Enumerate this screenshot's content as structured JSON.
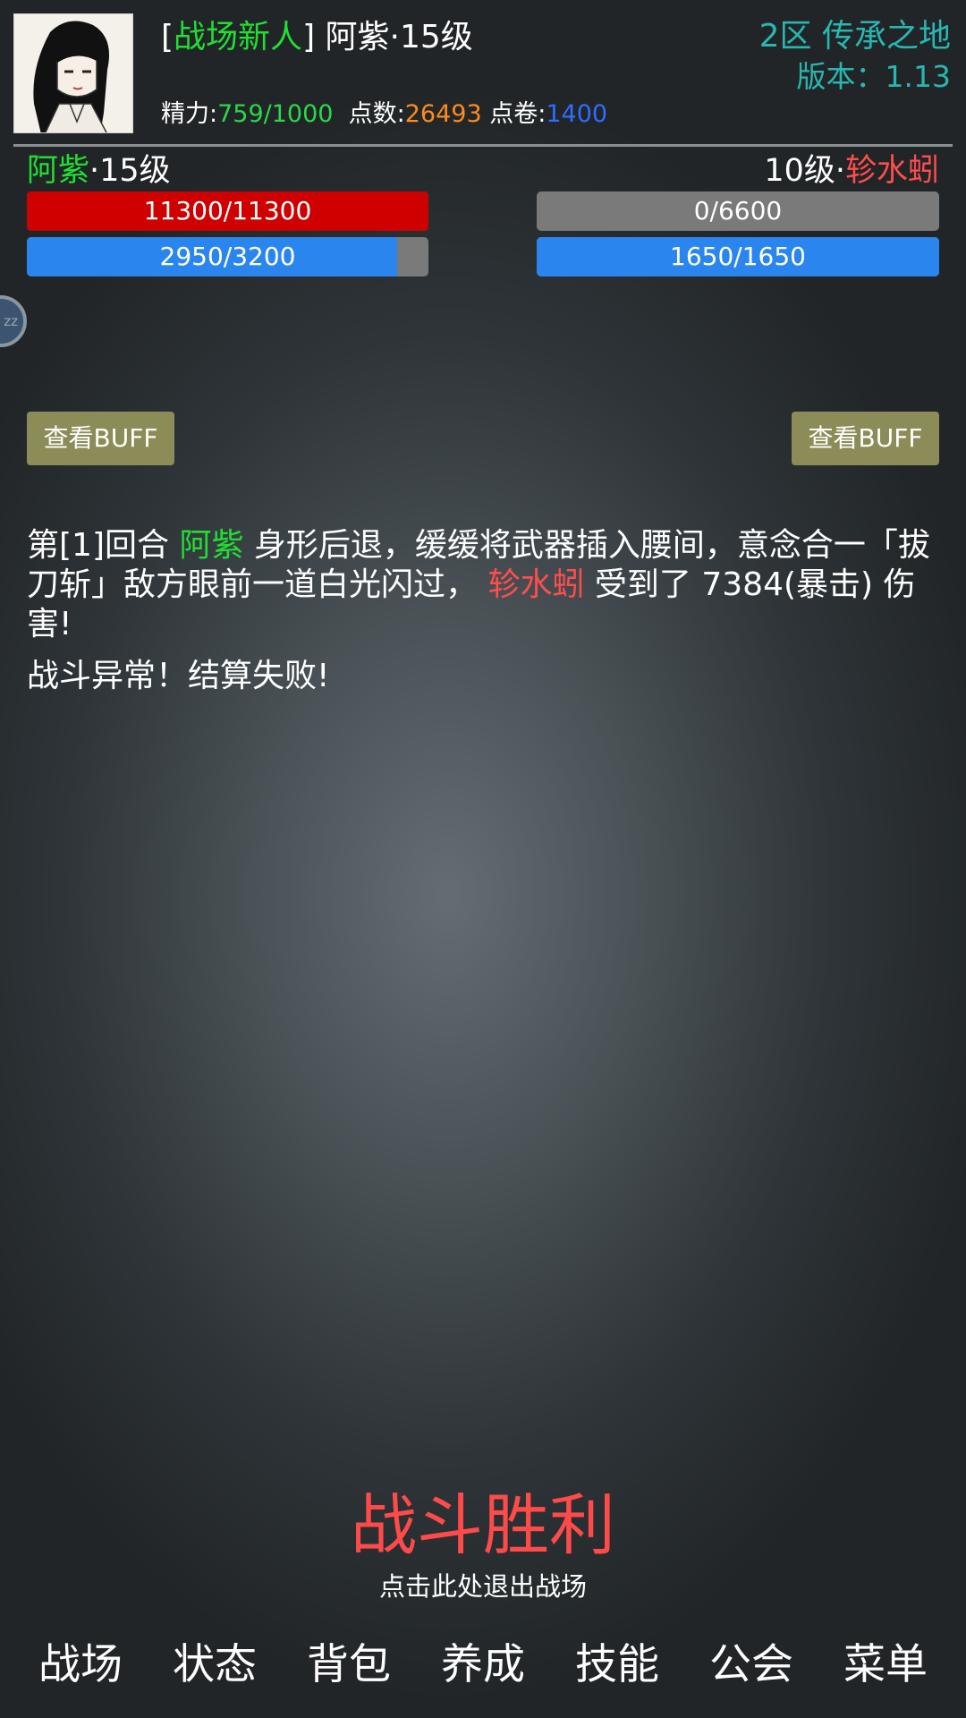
{
  "header": {
    "title_open": "[",
    "title_tag": "战场新人",
    "title_close": "]",
    "player_name_level": " 阿紫·15级",
    "stats": {
      "energy_label": "精力:",
      "energy_value": "759/1000",
      "points_label": "点数:",
      "points_value": "26493",
      "coupons_label": "点卷:",
      "coupons_value": "1400"
    },
    "server": "2区 传承之地",
    "version": "版本：1.13"
  },
  "player": {
    "name": "阿紫",
    "level": "·15级",
    "hp": {
      "text": "11300/11300",
      "fraction": 1.0
    },
    "mp": {
      "text": "2950/3200",
      "fraction": 0.922
    },
    "buff_button": "查看BUFF"
  },
  "enemy": {
    "level": "10级·",
    "name": "轸水蚓",
    "hp": {
      "text": "0/6600",
      "fraction": 0.0
    },
    "mp": {
      "text": "1650/1650",
      "fraction": 1.0
    },
    "buff_button": "查看BUFF"
  },
  "side_button": {
    "label": "zz"
  },
  "log": {
    "round": "第[1]回合 ",
    "actor": "阿紫",
    "action": " 身形后退，缓缓将武器插入腰间，意念合一「拔刀斩」敌方眼前一道白光闪过， ",
    "target": "轸水蚓",
    "damage": " 受到了 7384(暴击) 伤害!",
    "line2": "战斗异常！结算失败!"
  },
  "result": {
    "title": "战斗胜利",
    "hint": "点击此处退出战场"
  },
  "nav": [
    "战场",
    "状态",
    "背包",
    "养成",
    "技能",
    "公会",
    "菜单"
  ],
  "colors": {
    "accent_green": "#22dd33",
    "enemy_red": "#ff4d4d",
    "server_teal": "#29b6b0",
    "hp_red": "#cf0000",
    "mp_blue": "#2a86ee",
    "buff_olive": "#8c8c58"
  },
  "icons": {
    "avatar": "character-portrait"
  }
}
